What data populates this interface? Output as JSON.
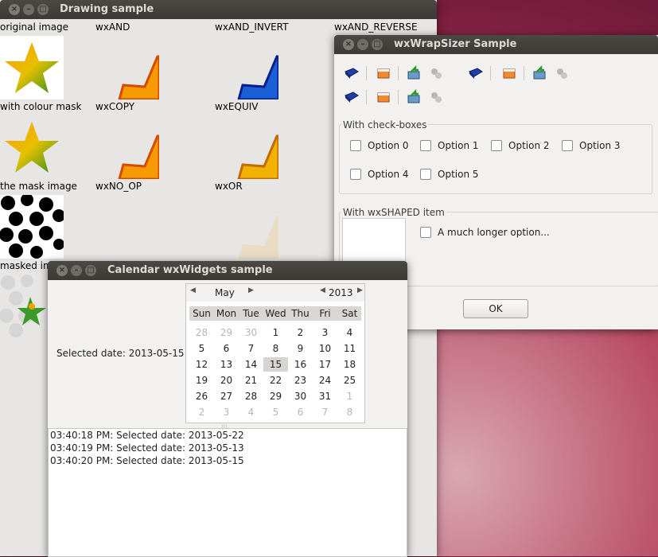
{
  "drawing": {
    "title": "Drawing sample",
    "labels": {
      "original": "original image",
      "and": "wxAND",
      "and_invert": "wxAND_INVERT",
      "and_reverse": "wxAND_REVERSE",
      "colour_mask": "with colour mask",
      "copy": "wxCOPY",
      "equiv": "wxEQUIV",
      "mask_image": "the mask image",
      "no_op": "wxNO_OP",
      "or": "wxOR",
      "masked": "masked im"
    }
  },
  "wrap": {
    "title": "wxWrapSizer Sample",
    "group1": "With check-boxes",
    "options": [
      "Option 0",
      "Option 1",
      "Option 2",
      "Option 3",
      "Option 4",
      "Option 5"
    ],
    "group2": "With wxSHAPED item",
    "long_option": "A much longer option...",
    "ok": "OK"
  },
  "calendar": {
    "title": "Calendar wxWidgets sample",
    "selected_label": "Selected date: 2013-05-15",
    "month": "May",
    "year": "2013",
    "weekdays": [
      "Sun",
      "Mon",
      "Tue",
      "Wed",
      "Thu",
      "Fri",
      "Sat"
    ],
    "weeks": [
      [
        "28",
        "29",
        "30",
        "1",
        "2",
        "3",
        "4"
      ],
      [
        "5",
        "6",
        "7",
        "8",
        "9",
        "10",
        "11"
      ],
      [
        "12",
        "13",
        "14",
        "15",
        "16",
        "17",
        "18"
      ],
      [
        "19",
        "20",
        "21",
        "22",
        "23",
        "24",
        "25"
      ],
      [
        "26",
        "27",
        "28",
        "29",
        "30",
        "31",
        "1"
      ],
      [
        "2",
        "3",
        "4",
        "5",
        "6",
        "7",
        "8"
      ]
    ],
    "log": [
      "03:40:18 PM: Selected date: 2013-05-22",
      "03:40:19 PM: Selected date: 2013-05-13",
      "03:40:20 PM: Selected date: 2013-05-15"
    ]
  },
  "colors": {
    "titlebar": "#3b3a36",
    "window": "#f2f1f0",
    "desktop": "#7a1d3d"
  }
}
